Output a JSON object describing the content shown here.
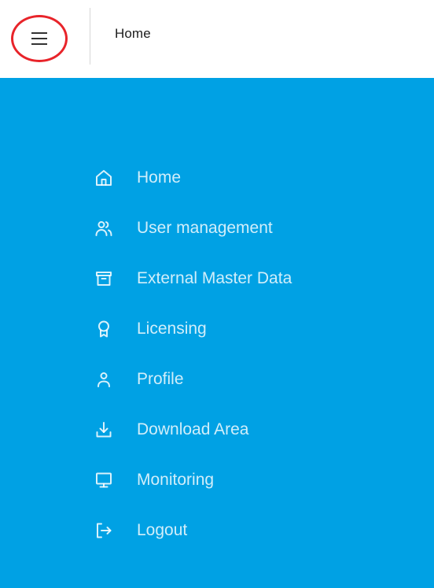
{
  "header": {
    "menu_icon": "hamburger-menu-icon",
    "title": "Home",
    "highlight_color": "#e8242a"
  },
  "sidebar": {
    "background_color": "#00a1e4",
    "items": [
      {
        "label": "Home",
        "icon": "home-icon"
      },
      {
        "label": "User management",
        "icon": "users-icon"
      },
      {
        "label": "External Master Data",
        "icon": "archive-box-icon"
      },
      {
        "label": "Licensing",
        "icon": "award-ribbon-icon"
      },
      {
        "label": "Profile",
        "icon": "user-icon"
      },
      {
        "label": "Download Area",
        "icon": "download-icon"
      },
      {
        "label": "Monitoring",
        "icon": "monitor-icon"
      },
      {
        "label": "Logout",
        "icon": "logout-icon"
      }
    ]
  }
}
